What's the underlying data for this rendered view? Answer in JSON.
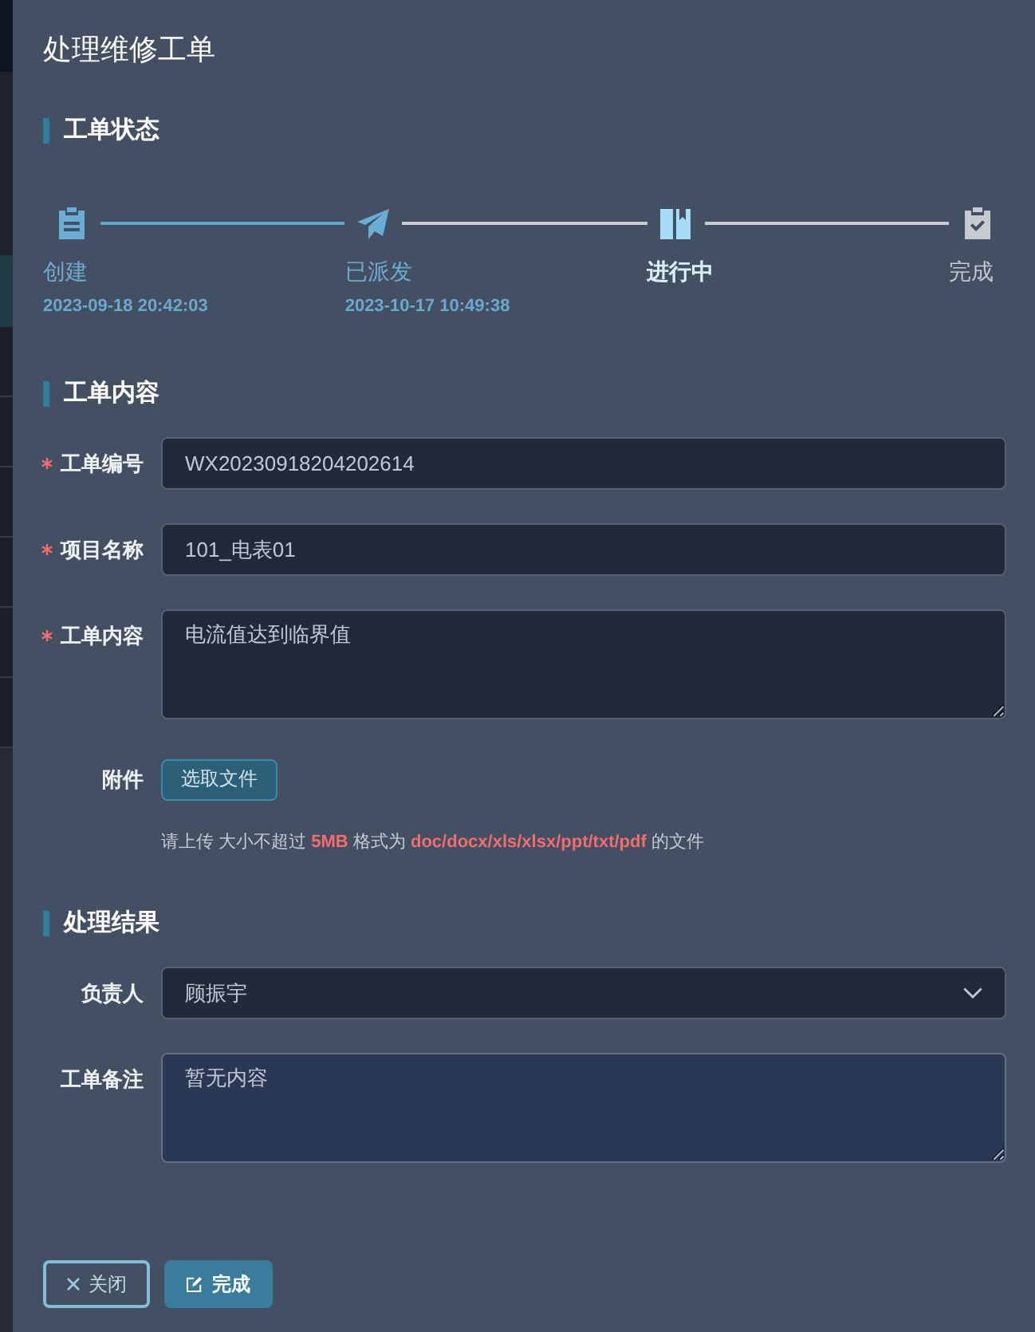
{
  "drawer": {
    "title": "处理维修工单"
  },
  "status_section": {
    "title": "工单状态",
    "steps": [
      {
        "label": "创建",
        "time": "2023-09-18 20:42:03",
        "finished": true,
        "active": false
      },
      {
        "label": "已派发",
        "time": "2023-10-17 10:49:38",
        "finished": true,
        "active": false
      },
      {
        "label": "进行中",
        "finished": false,
        "active": true
      },
      {
        "label": "完成",
        "finished": false,
        "active": false
      }
    ]
  },
  "content_section": {
    "title": "工单内容",
    "fields": [
      {
        "kind": "input",
        "label": "工单编号",
        "required": true,
        "focused": false,
        "value": "WX20230918204202614"
      },
      {
        "kind": "input",
        "label": "项目名称",
        "required": true,
        "focused": false,
        "value": "101_电表01"
      },
      {
        "kind": "textarea",
        "label": "工单内容",
        "required": true,
        "focused": false,
        "value": "电流值达到临界值"
      },
      {
        "kind": "upload",
        "label": "附件",
        "required": false,
        "button": "选取文件",
        "hint": "请上传 大小不超过 **5MB** 格式为 **doc/docx/xls/xlsx/ppt/txt/pdf** 的文件"
      }
    ]
  },
  "result_section": {
    "title": "处理结果",
    "fields": [
      {
        "kind": "select",
        "label": "负责人",
        "required": false,
        "focused": false,
        "value": "顾振宇"
      },
      {
        "kind": "textarea",
        "label": "工单备注",
        "required": false,
        "focused": true,
        "placeholder": "暂无内容"
      }
    ]
  },
  "buttons": [
    {
      "kind": "close",
      "label": "关闭"
    },
    {
      "kind": "submit",
      "label": "完成"
    }
  ]
}
